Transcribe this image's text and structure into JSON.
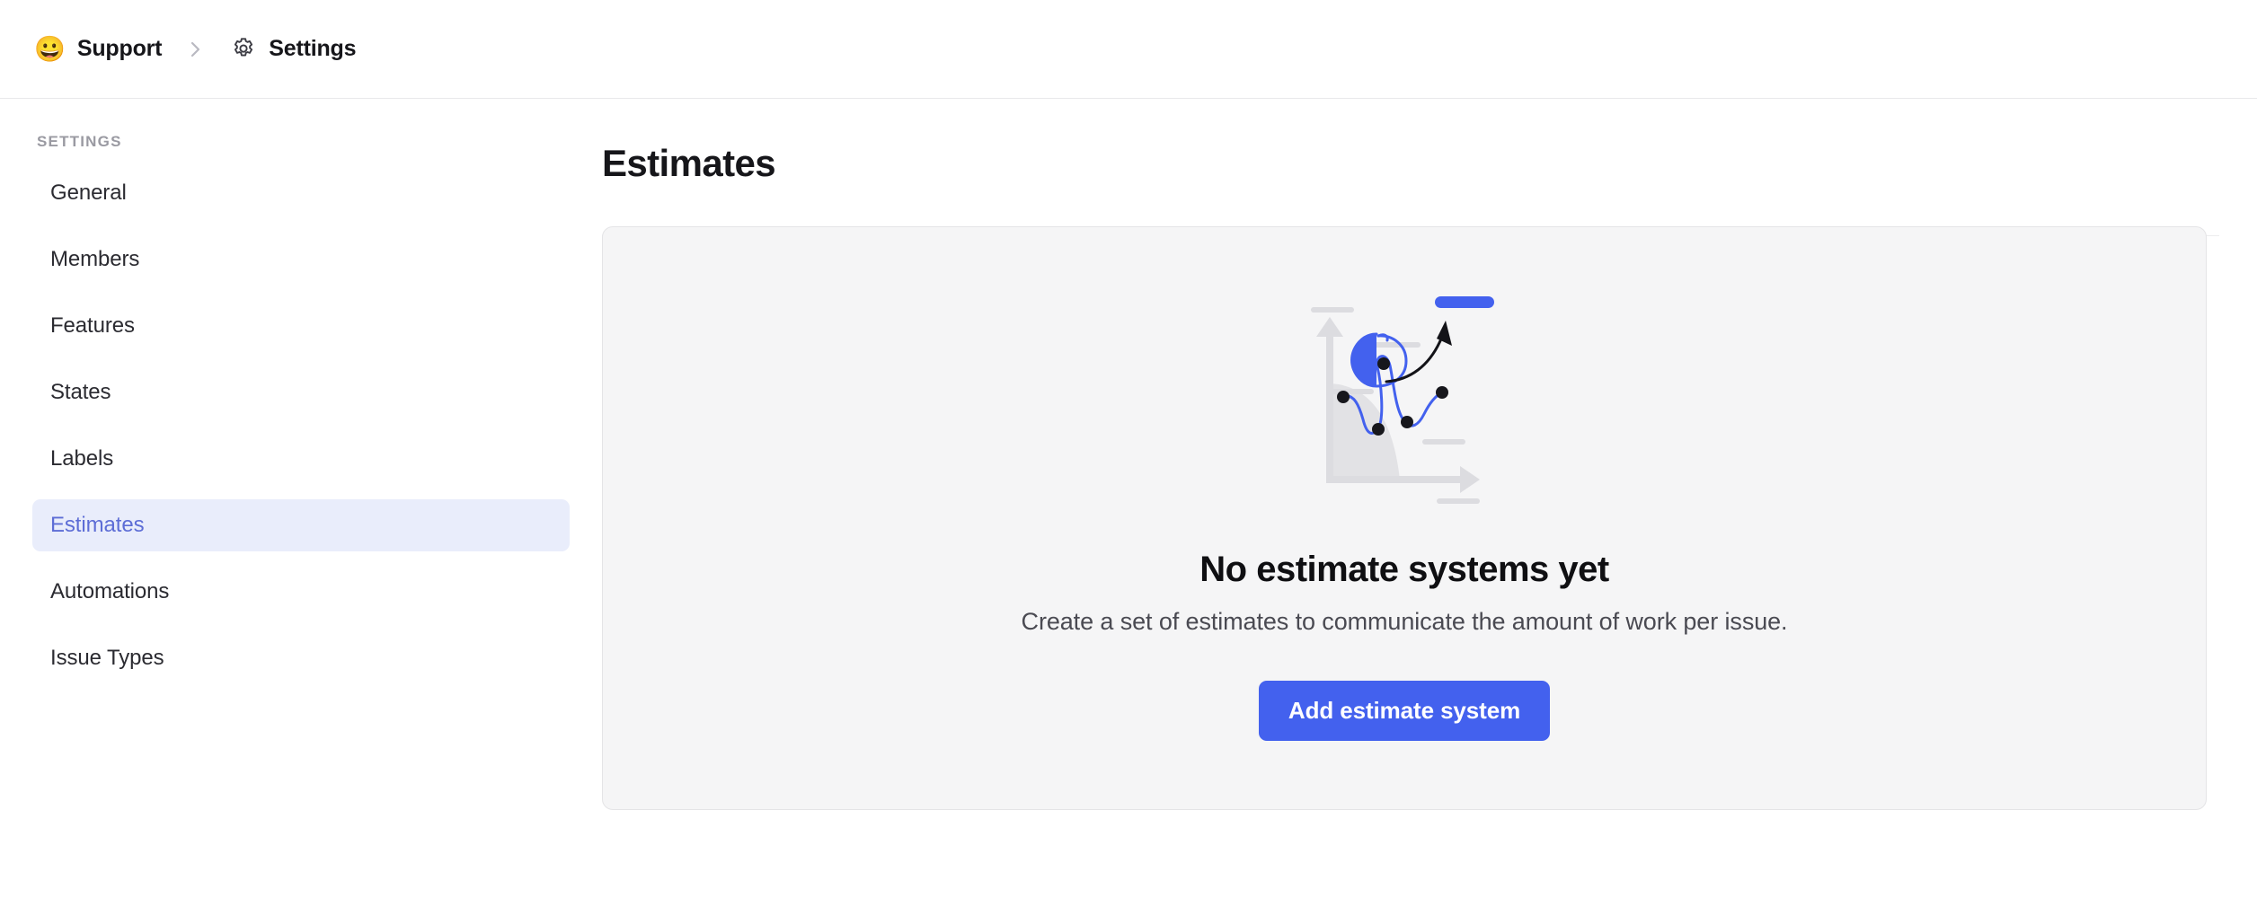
{
  "breadcrumb": {
    "workspace_emoji": "😀",
    "workspace_emoji_name": "grinning-face-emoji",
    "workspace": "Support",
    "separator_icon": "chevron-right-icon",
    "section_icon": "gear-icon",
    "section": "Settings"
  },
  "sidebar": {
    "heading": "SETTINGS",
    "items": [
      {
        "label": "General",
        "active": false
      },
      {
        "label": "Members",
        "active": false
      },
      {
        "label": "Features",
        "active": false
      },
      {
        "label": "States",
        "active": false
      },
      {
        "label": "Labels",
        "active": false
      },
      {
        "label": "Estimates",
        "active": true
      },
      {
        "label": "Automations",
        "active": false
      },
      {
        "label": "Issue Types",
        "active": false
      }
    ]
  },
  "main": {
    "page_title": "Estimates",
    "empty_state": {
      "illustration_name": "estimates-chart-illustration",
      "title": "No estimate systems yet",
      "subtitle": "Create a set of estimates to communicate the amount of work per issue.",
      "cta_label": "Add estimate system"
    }
  },
  "colors": {
    "accent_blue": "#4361ee",
    "active_item_bg": "#e9edfb",
    "active_item_text": "#5d6dd6",
    "card_bg": "#f5f5f6",
    "card_border": "#e4e4e6",
    "muted_text": "#9a9aa2",
    "illustration_gray": "#dcdce0",
    "illustration_dot": "#17171c"
  }
}
